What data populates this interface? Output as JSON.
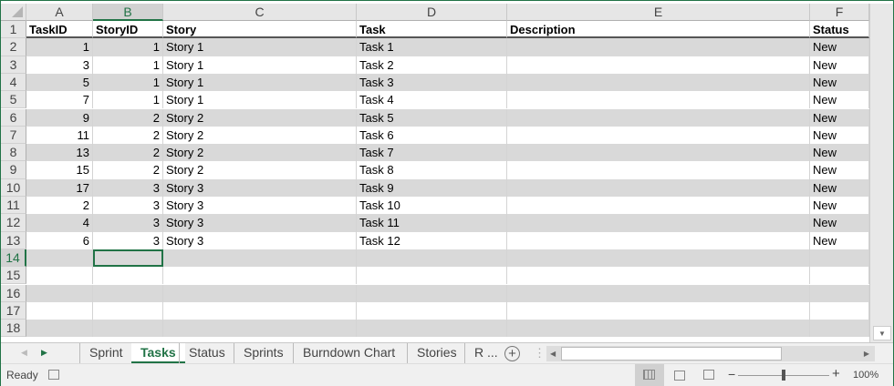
{
  "columns": [
    "A",
    "B",
    "C",
    "D",
    "E",
    "F"
  ],
  "selected_column": "B",
  "row_numbers": [
    "1",
    "2",
    "3",
    "4",
    "5",
    "6",
    "7",
    "8",
    "9",
    "10",
    "11",
    "12",
    "13",
    "14",
    "15",
    "16",
    "17",
    "18"
  ],
  "headers": [
    "TaskID",
    "StoryID",
    "Story",
    "Task",
    "Description",
    "Status"
  ],
  "rows": [
    [
      "1",
      "1",
      "Story 1",
      "Task 1",
      "",
      "New"
    ],
    [
      "3",
      "1",
      "Story 1",
      "Task 2",
      "",
      "New"
    ],
    [
      "5",
      "1",
      "Story 1",
      "Task 3",
      "",
      "New"
    ],
    [
      "7",
      "1",
      "Story 1",
      "Task 4",
      "",
      "New"
    ],
    [
      "9",
      "2",
      "Story 2",
      "Task 5",
      "",
      "New"
    ],
    [
      "11",
      "2",
      "Story 2",
      "Task 6",
      "",
      "New"
    ],
    [
      "13",
      "2",
      "Story 2",
      "Task 7",
      "",
      "New"
    ],
    [
      "15",
      "2",
      "Story 2",
      "Task 8",
      "",
      "New"
    ],
    [
      "17",
      "3",
      "Story 3",
      "Task 9",
      "",
      "New"
    ],
    [
      "2",
      "3",
      "Story 3",
      "Task 10",
      "",
      "New"
    ],
    [
      "4",
      "3",
      "Story 3",
      "Task 11",
      "",
      "New"
    ],
    [
      "6",
      "3",
      "Story 3",
      "Task 12",
      "",
      "New"
    ]
  ],
  "active_cell": "B14",
  "sheet_tabs": [
    "Sprint",
    "Tasks",
    "Status",
    "Sprints",
    "Burndown Chart",
    "Stories",
    "R ..."
  ],
  "active_tab": "Tasks",
  "status": {
    "ready": "Ready",
    "zoom": "100%"
  },
  "accent": "#217346"
}
